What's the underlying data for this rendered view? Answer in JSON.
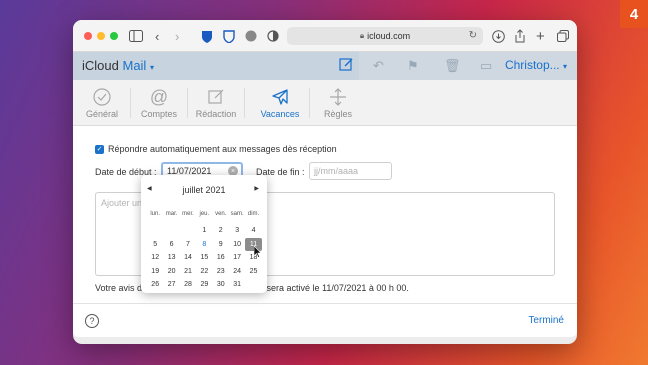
{
  "badge": "4",
  "browser": {
    "url": "icloud.com"
  },
  "app": {
    "brand_prefix": "iCloud",
    "brand_mail": "Mail",
    "user": "Christop..."
  },
  "tabs": [
    {
      "label": "Général",
      "icon": "checkmark-circle-icon",
      "active": false
    },
    {
      "label": "Comptes",
      "icon": "at-sign-icon",
      "active": false
    },
    {
      "label": "Rédaction",
      "icon": "compose-icon",
      "active": false
    },
    {
      "label": "Vacances",
      "icon": "airplane-icon",
      "active": true
    },
    {
      "label": "Règles",
      "icon": "arrows-move-icon",
      "active": false
    }
  ],
  "form": {
    "auto_reply_label": "Répondre automatiquement aux messages dès réception",
    "auto_reply_checked": true,
    "start_label": "Date de début :",
    "start_value": "11/07/2021",
    "end_label": "Date de fin :",
    "end_placeholder": "jj/mm/aaaa",
    "message_placeholder_visible": "Ajouter un",
    "status_start": "Votre avis d",
    "status_end": "l sera activé le 11/07/2021 à 00 h 00."
  },
  "calendar": {
    "month": "juillet 2021",
    "weekdays": [
      "lun.",
      "mar.",
      "mer.",
      "jeu.",
      "ven.",
      "sam.",
      "dim."
    ],
    "weeks": [
      [
        "",
        "",
        "",
        "1",
        "2",
        "3",
        "4"
      ],
      [
        "5",
        "6",
        "7",
        "8",
        "9",
        "10",
        "11"
      ],
      [
        "12",
        "13",
        "14",
        "15",
        "16",
        "17",
        "18"
      ],
      [
        "19",
        "20",
        "21",
        "22",
        "23",
        "24",
        "25"
      ],
      [
        "26",
        "27",
        "28",
        "29",
        "30",
        "31",
        ""
      ]
    ],
    "today": "8",
    "selected": "11"
  },
  "footer": {
    "help_label": "?",
    "done_label": "Terminé"
  }
}
